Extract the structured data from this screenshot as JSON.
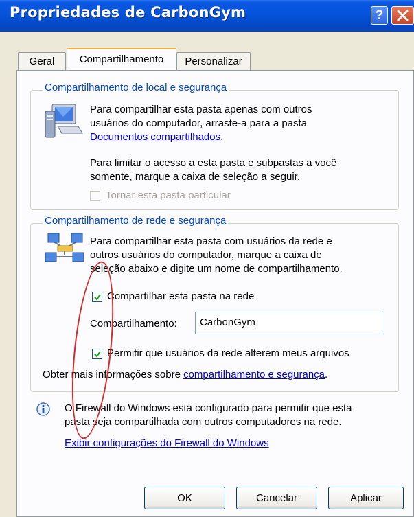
{
  "window": {
    "title": "Propriedades de CarbonGym",
    "help": "?",
    "close": "✕"
  },
  "tabs": [
    {
      "label": "Geral"
    },
    {
      "label": "Compartilhamento"
    },
    {
      "label": "Personalizar"
    }
  ],
  "local": {
    "legend": "Compartilhamento de local e segurança",
    "para1_line1": "Para compartilhar esta pasta apenas com outros",
    "para1_line2": "usuários do computador, arraste-a para a pasta",
    "para1_link": "Documentos compartilhados",
    "para1_end": ".",
    "para2_line1": "Para limitar o acesso a esta pasta e subpastas a você",
    "para2_line2": "somente, marque a caixa de seleção a seguir.",
    "private_checkbox": "Tornar esta pasta particular"
  },
  "network": {
    "legend": "Compartilhamento de rede e segurança",
    "line1": "Para compartilhar esta pasta com usuários da rede e",
    "line2": "outros usuários do computador, marque a caixa de",
    "line3": "seleção abaixo e digite um nome de compartilhamento.",
    "share_checkbox": "Compartilhar esta pasta na rede",
    "share_name_label": "Compartilhamento:",
    "share_name_value": "CarbonGym",
    "allow_checkbox": "Permitir que usuários da rede alterem meus arquivos",
    "more_info": "Obter mais informações sobre ",
    "more_info_link": "compartilhamento e segurança",
    "more_info_end": "."
  },
  "firewall": {
    "line1": "O Firewall do Windows está configurado para permitir que esta",
    "line2": "pasta seja compartilhada com outros computadores na rede.",
    "link": "Exibir configurações do Firewall do Windows"
  },
  "buttons": {
    "ok": "OK",
    "cancel": "Cancelar",
    "apply": "Aplicar"
  },
  "colors": {
    "titlebar": "#0554dc",
    "legend": "#0046d5",
    "link": "#0000cc",
    "annotation": "#d32b2b"
  },
  "icons": [
    "monitor-icon",
    "network-icon",
    "info-icon",
    "checkmark-icon"
  ]
}
